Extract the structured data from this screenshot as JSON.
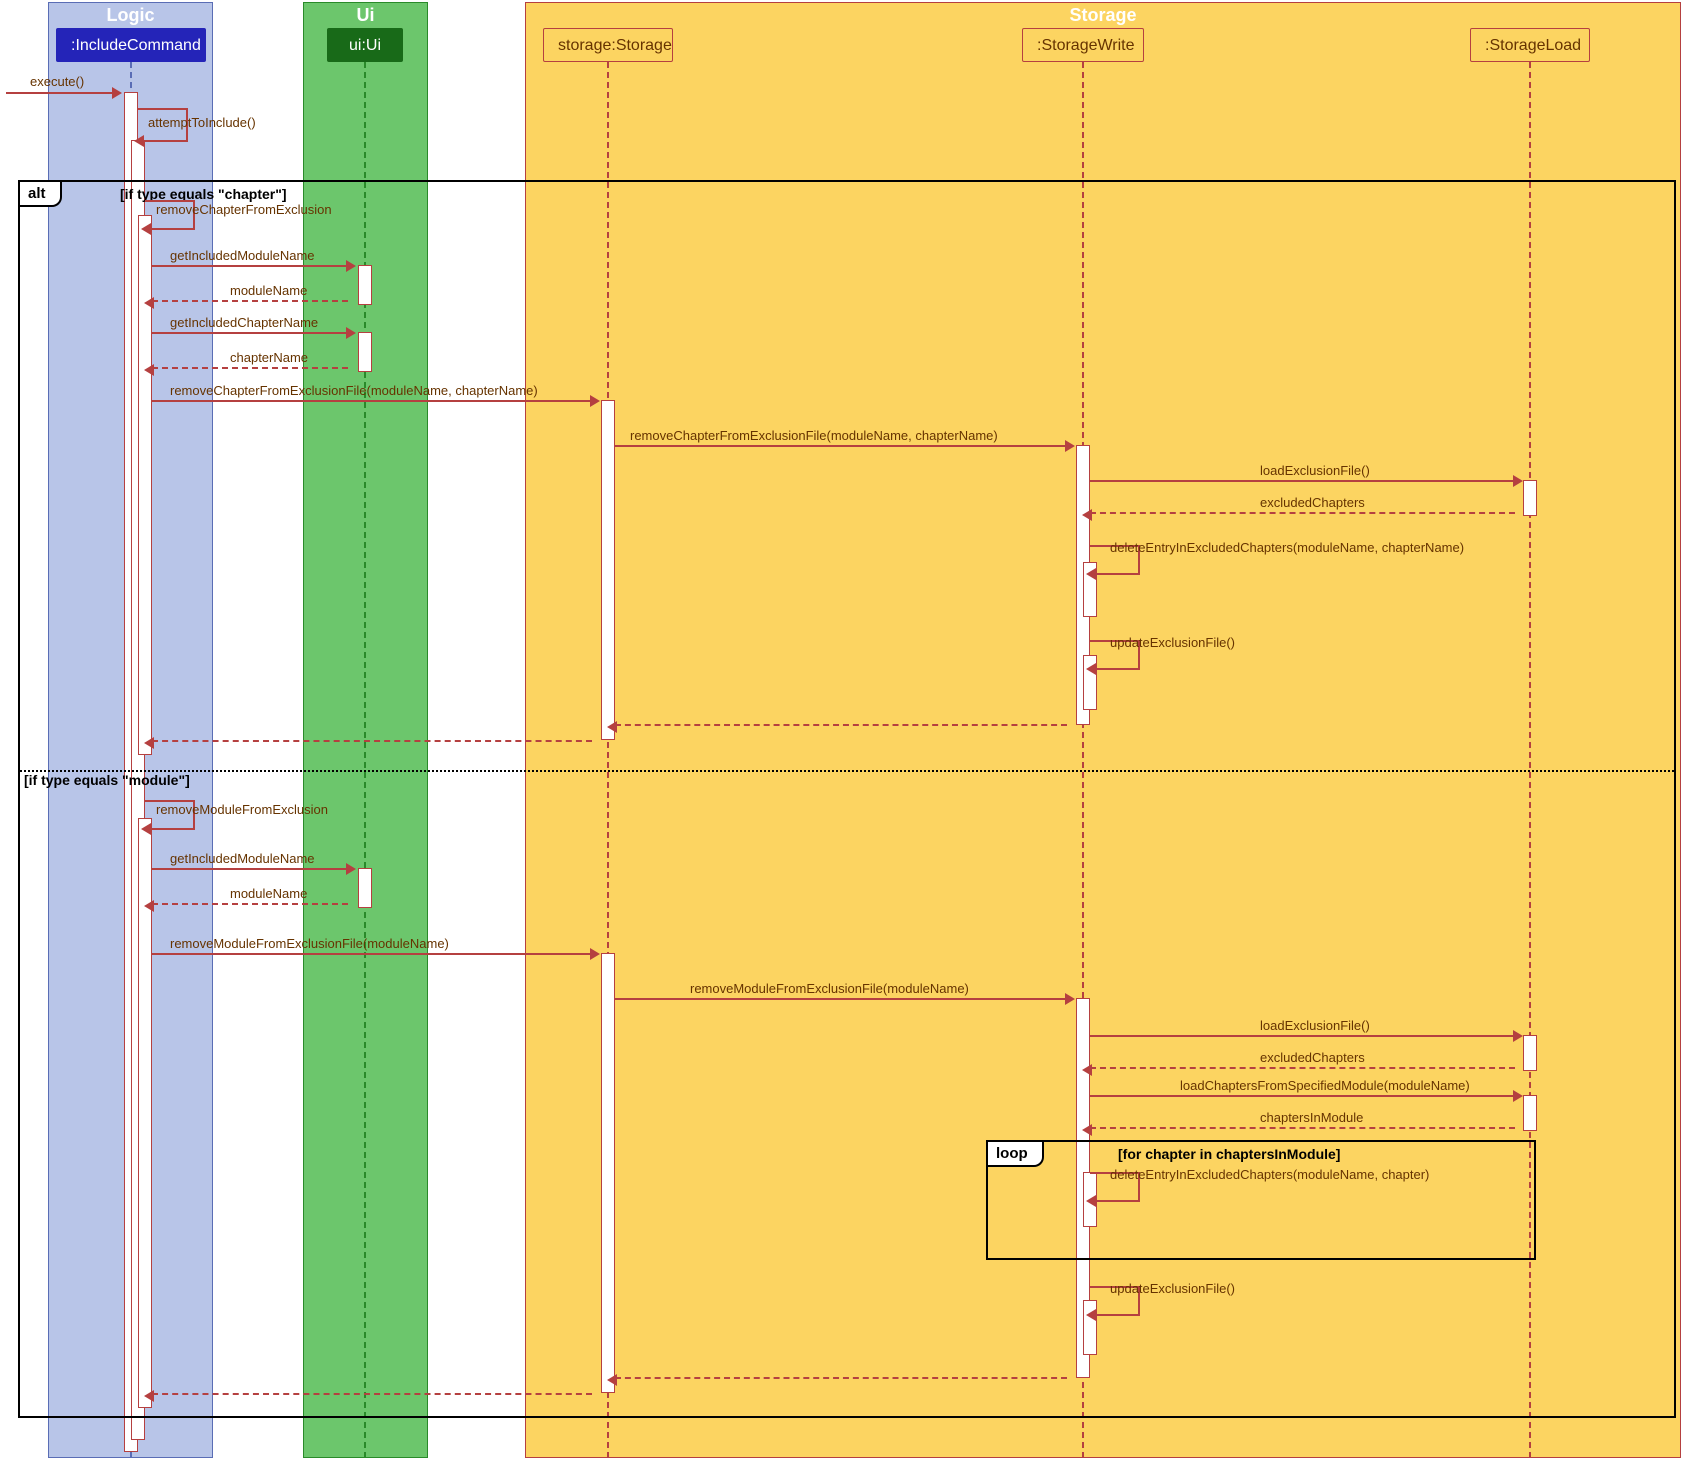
{
  "groups": {
    "logic": "Logic",
    "ui": "Ui",
    "storage": "Storage"
  },
  "participants": {
    "includeCommand": ":IncludeCommand",
    "ui": "ui:Ui",
    "storage": "storage:Storage",
    "storageWrite": ":StorageWrite",
    "storageLoad": ":StorageLoad"
  },
  "frames": {
    "alt": {
      "title": "alt",
      "cond1": "[if type equals \"chapter\"]",
      "cond2": "[if type equals \"module\"]"
    },
    "loop": {
      "title": "loop",
      "cond": "[for chapter in chaptersInModule]"
    }
  },
  "messages": {
    "execute": "execute()",
    "attemptToInclude": "attemptToInclude()",
    "removeChapterFromExclusion": "removeChapterFromExclusion",
    "getIncludedModuleName": "getIncludedModuleName",
    "moduleName": "moduleName",
    "getIncludedChapterName": "getIncludedChapterName",
    "chapterName": "chapterName",
    "removeChapterFromExclusionFile": "removeChapterFromExclusionFile(moduleName, chapterName)",
    "loadExclusionFile": "loadExclusionFile()",
    "excludedChapters": "excludedChapters",
    "deleteEntryInExcludedChapters": "deleteEntryInExcludedChapters(moduleName, chapterName)",
    "updateExclusionFile": "updateExclusionFile()",
    "removeModuleFromExclusion": "removeModuleFromExclusion",
    "removeModuleFromExclusionFile": "removeModuleFromExclusionFile(moduleName)",
    "loadChaptersFromSpecifiedModule": "loadChaptersFromSpecifiedModule(moduleName)",
    "chaptersInModule": "chaptersInModule",
    "deleteEntryLoop": "deleteEntryInExcludedChapters(moduleName, chapter)"
  },
  "chart_data": {
    "type": "sequence-diagram",
    "groups": [
      {
        "name": "Logic",
        "participants": [
          ":IncludeCommand"
        ]
      },
      {
        "name": "Ui",
        "participants": [
          "ui:Ui"
        ]
      },
      {
        "name": "Storage",
        "participants": [
          "storage:Storage",
          ":StorageWrite",
          ":StorageLoad"
        ]
      }
    ],
    "participants": [
      ":IncludeCommand",
      "ui:Ui",
      "storage:Storage",
      ":StorageWrite",
      ":StorageLoad"
    ],
    "messages": [
      {
        "from": "external",
        "to": ":IncludeCommand",
        "label": "execute()",
        "type": "call"
      },
      {
        "from": ":IncludeCommand",
        "to": ":IncludeCommand",
        "label": "attemptToInclude()",
        "type": "self"
      },
      {
        "fragment": "alt",
        "guards": [
          "if type equals \"chapter\"",
          "if type equals \"module\""
        ],
        "branches": [
          [
            {
              "from": ":IncludeCommand",
              "to": ":IncludeCommand",
              "label": "removeChapterFromExclusion",
              "type": "self"
            },
            {
              "from": ":IncludeCommand",
              "to": "ui:Ui",
              "label": "getIncludedModuleName",
              "type": "call"
            },
            {
              "from": "ui:Ui",
              "to": ":IncludeCommand",
              "label": "moduleName",
              "type": "return"
            },
            {
              "from": ":IncludeCommand",
              "to": "ui:Ui",
              "label": "getIncludedChapterName",
              "type": "call"
            },
            {
              "from": "ui:Ui",
              "to": ":IncludeCommand",
              "label": "chapterName",
              "type": "return"
            },
            {
              "from": ":IncludeCommand",
              "to": "storage:Storage",
              "label": "removeChapterFromExclusionFile(moduleName, chapterName)",
              "type": "call"
            },
            {
              "from": "storage:Storage",
              "to": ":StorageWrite",
              "label": "removeChapterFromExclusionFile(moduleName, chapterName)",
              "type": "call"
            },
            {
              "from": ":StorageWrite",
              "to": ":StorageLoad",
              "label": "loadExclusionFile()",
              "type": "call"
            },
            {
              "from": ":StorageLoad",
              "to": ":StorageWrite",
              "label": "excludedChapters",
              "type": "return"
            },
            {
              "from": ":StorageWrite",
              "to": ":StorageWrite",
              "label": "deleteEntryInExcludedChapters(moduleName, chapterName)",
              "type": "self"
            },
            {
              "from": ":StorageWrite",
              "to": ":StorageWrite",
              "label": "updateExclusionFile()",
              "type": "self"
            },
            {
              "from": ":StorageWrite",
              "to": "storage:Storage",
              "type": "return"
            },
            {
              "from": "storage:Storage",
              "to": ":IncludeCommand",
              "type": "return"
            }
          ],
          [
            {
              "from": ":IncludeCommand",
              "to": ":IncludeCommand",
              "label": "removeModuleFromExclusion",
              "type": "self"
            },
            {
              "from": ":IncludeCommand",
              "to": "ui:Ui",
              "label": "getIncludedModuleName",
              "type": "call"
            },
            {
              "from": "ui:Ui",
              "to": ":IncludeCommand",
              "label": "moduleName",
              "type": "return"
            },
            {
              "from": ":IncludeCommand",
              "to": "storage:Storage",
              "label": "removeModuleFromExclusionFile(moduleName)",
              "type": "call"
            },
            {
              "from": "storage:Storage",
              "to": ":StorageWrite",
              "label": "removeModuleFromExclusionFile(moduleName)",
              "type": "call"
            },
            {
              "from": ":StorageWrite",
              "to": ":StorageLoad",
              "label": "loadExclusionFile()",
              "type": "call"
            },
            {
              "from": ":StorageLoad",
              "to": ":StorageWrite",
              "label": "excludedChapters",
              "type": "return"
            },
            {
              "from": ":StorageWrite",
              "to": ":StorageLoad",
              "label": "loadChaptersFromSpecifiedModule(moduleName)",
              "type": "call"
            },
            {
              "from": ":StorageLoad",
              "to": ":StorageWrite",
              "label": "chaptersInModule",
              "type": "return"
            },
            {
              "fragment": "loop",
              "guard": "for chapter in chaptersInModule",
              "body": [
                {
                  "from": ":StorageWrite",
                  "to": ":StorageWrite",
                  "label": "deleteEntryInExcludedChapters(moduleName, chapter)",
                  "type": "self"
                }
              ]
            },
            {
              "from": ":StorageWrite",
              "to": ":StorageWrite",
              "label": "updateExclusionFile()",
              "type": "self"
            },
            {
              "from": ":StorageWrite",
              "to": "storage:Storage",
              "type": "return"
            },
            {
              "from": "storage:Storage",
              "to": ":IncludeCommand",
              "type": "return"
            }
          ]
        ]
      }
    ]
  }
}
